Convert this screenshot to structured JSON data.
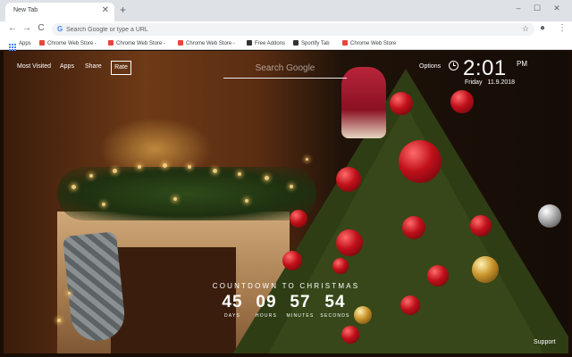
{
  "browser": {
    "tab_title": "New Tab",
    "tab_close": "✕",
    "new_tab": "+",
    "window_controls": {
      "minimize": "–",
      "maximize": "☐",
      "close": "✕"
    },
    "nav": {
      "back": "←",
      "forward": "→",
      "reload": "C"
    },
    "omnibox": {
      "google_icon": "G",
      "placeholder": "Search Google or type a URL"
    },
    "toolbar_icons": {
      "star": "☆",
      "profile": "●",
      "menu": "⋮"
    }
  },
  "bookmarks": [
    {
      "label": "Apps",
      "icon": "apps-grid-icon"
    },
    {
      "label": "Chrome Web Store -",
      "icon": "chrome-web-store-icon"
    },
    {
      "label": "Chrome Web Store -",
      "icon": "chrome-web-store-icon"
    },
    {
      "label": "Chrome Web Store -",
      "icon": "chrome-web-store-icon"
    },
    {
      "label": "Free Addons",
      "icon": "addons-icon"
    },
    {
      "label": "Sportify Tab",
      "icon": "sportify-icon"
    },
    {
      "label": "Chrome Web Store",
      "icon": "chrome-web-store-icon"
    }
  ],
  "newtab": {
    "nav": {
      "most_visited": "Most Visited",
      "apps": "Apps",
      "share": "Share",
      "rate": "Rate"
    },
    "search_placeholder": "Search Google",
    "options": "Options",
    "clock": {
      "time": "2:01",
      "ampm": "PM",
      "day": "Friday",
      "date": "11.9.2018"
    },
    "countdown": {
      "title": "COUNTDOWN TO CHRISTMAS",
      "days": "45",
      "hours": "09",
      "minutes": "57",
      "seconds": "54",
      "labels": {
        "days": "DAYS",
        "hours": "HOURS",
        "minutes": "MINUTES",
        "seconds": "SECONDS"
      }
    },
    "support": "Support"
  },
  "colors": {
    "tabstrip": "#dee1e6",
    "omnibox": "#f1f3f4",
    "ornament_red": "#c0101a",
    "tree_green": "#2f3d14"
  }
}
